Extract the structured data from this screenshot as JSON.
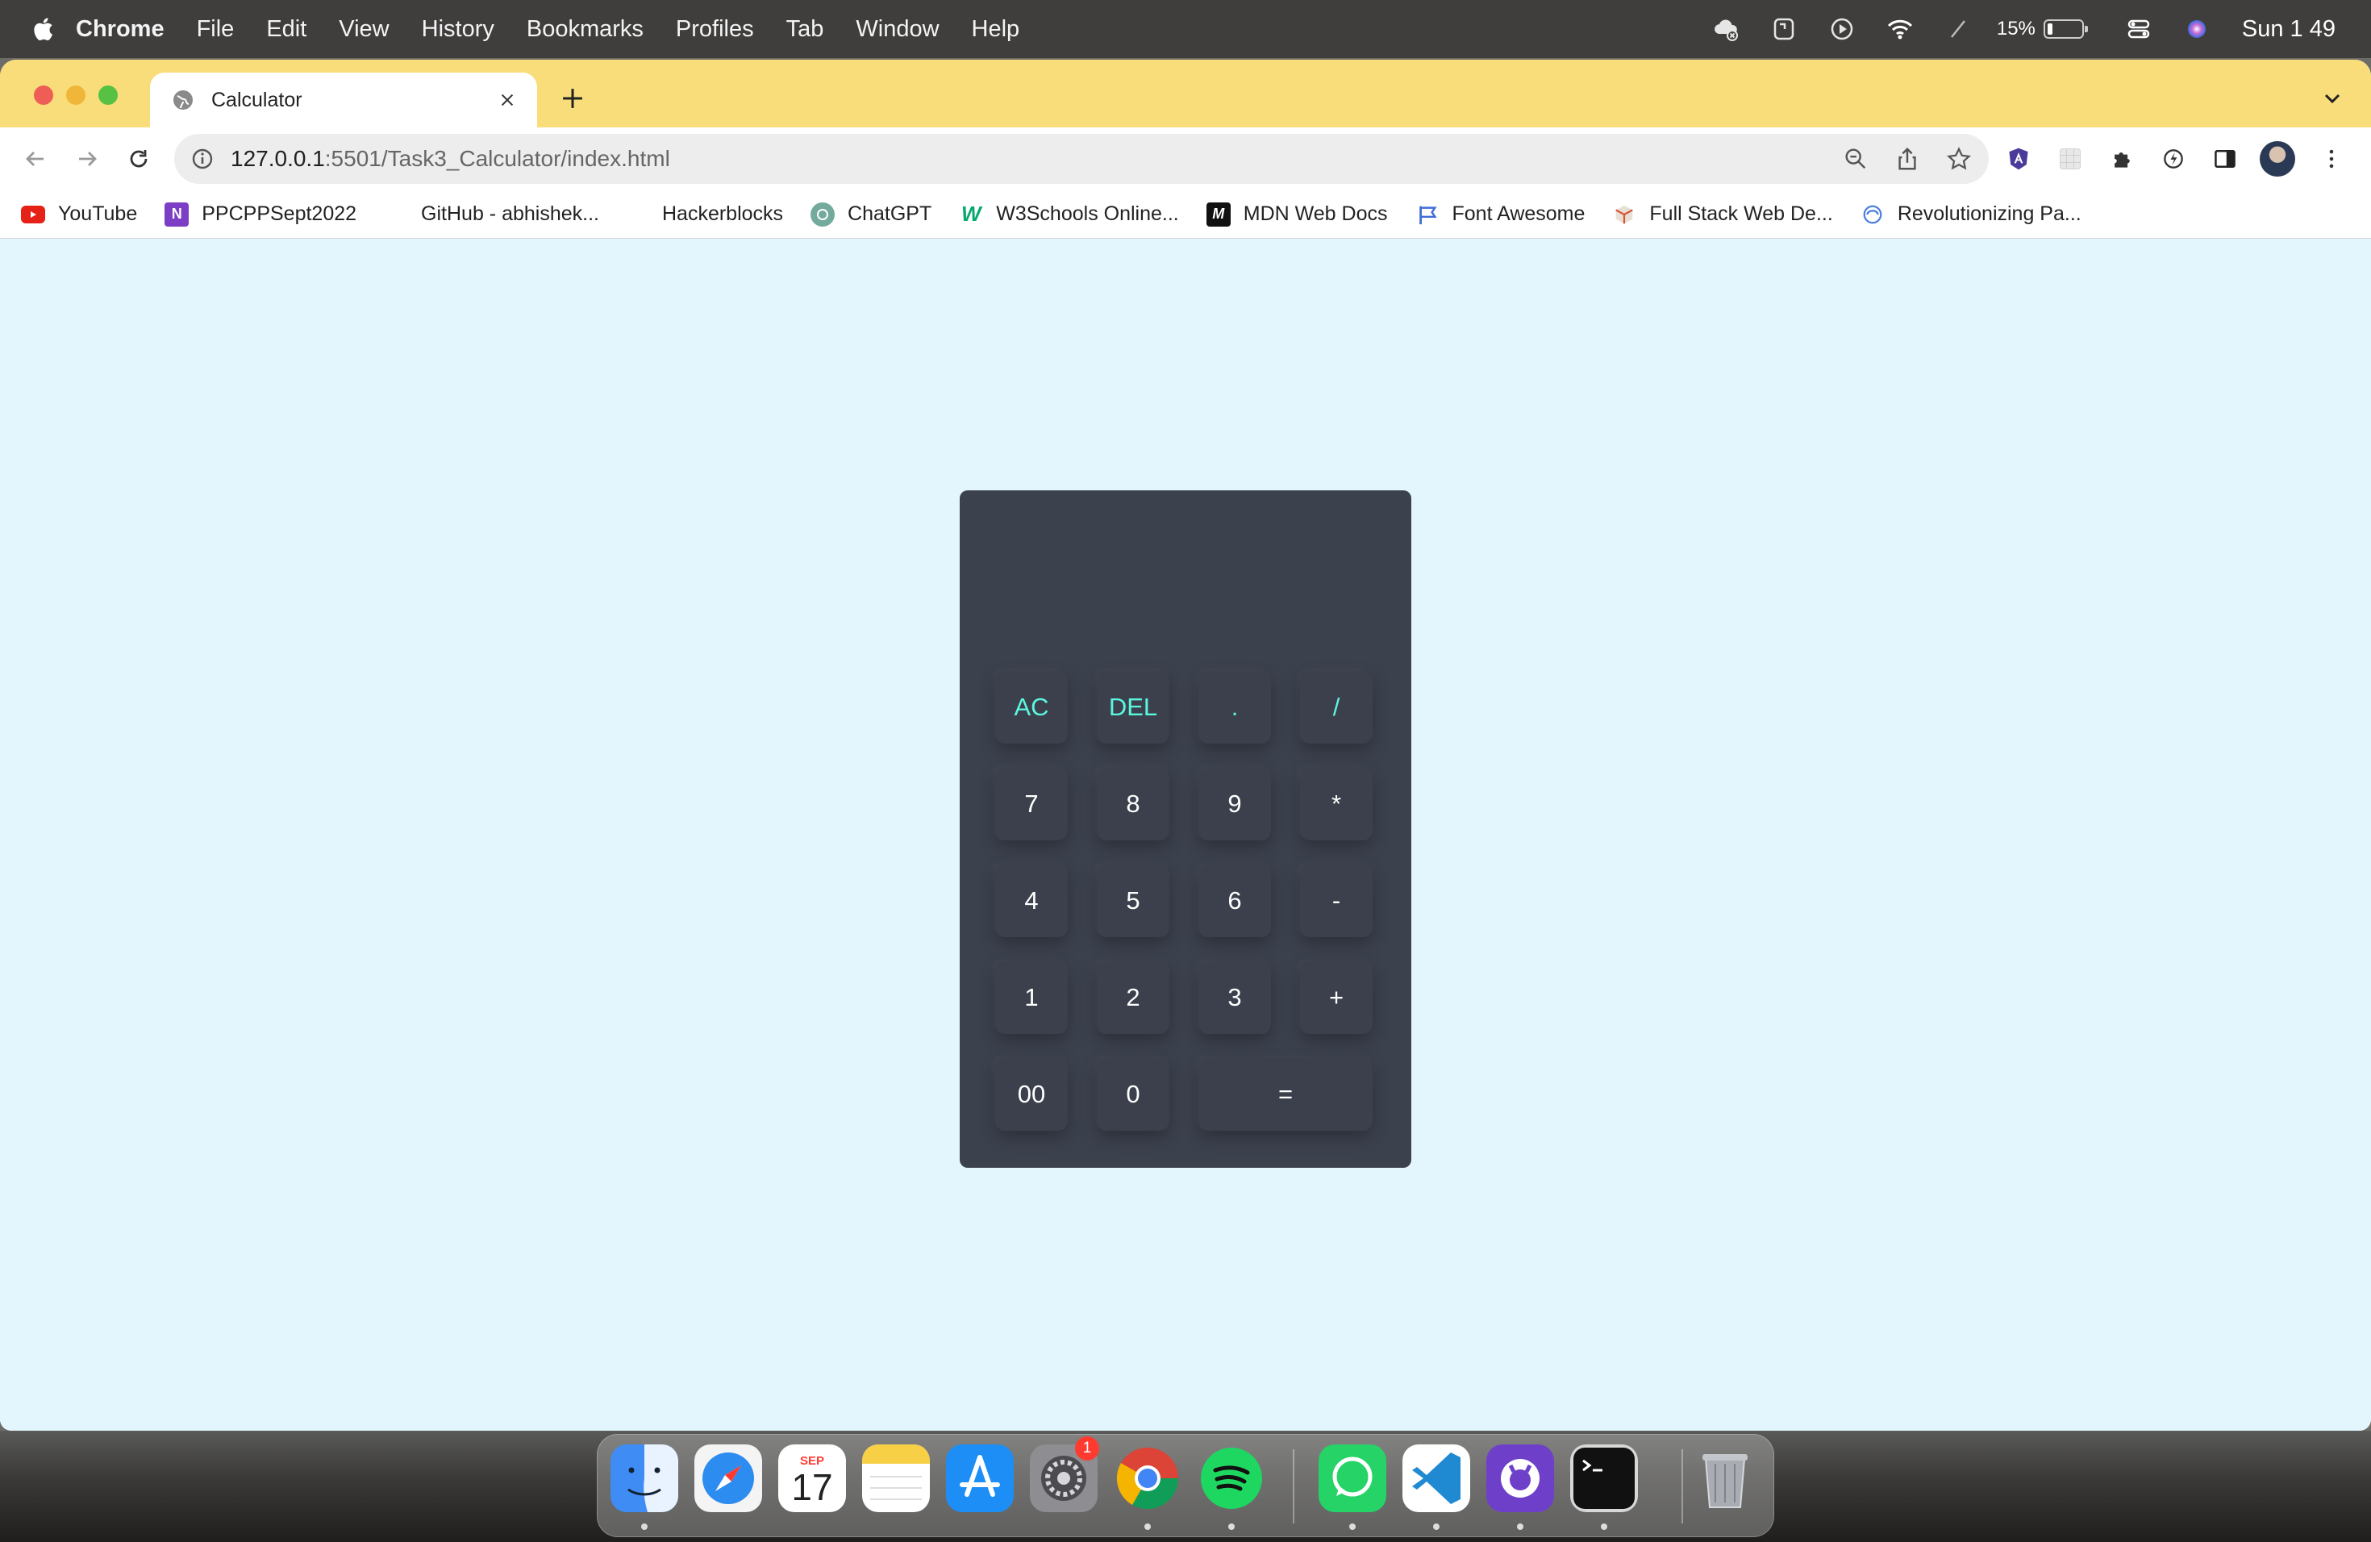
{
  "menubar": {
    "app_name": "Chrome",
    "items": [
      "File",
      "Edit",
      "View",
      "History",
      "Bookmarks",
      "Profiles",
      "Tab",
      "Window",
      "Help"
    ],
    "battery_percent": "15%",
    "battery_level": 0.15,
    "clock": "Sun 1 49"
  },
  "browser": {
    "tab_title": "Calculator",
    "url_host": "127.0.0.1",
    "url_rest": ":5501/Task3_Calculator/index.html",
    "bookmarks": [
      {
        "label": "YouTube",
        "icon": "youtube-icon"
      },
      {
        "label": "PPCPPSept2022",
        "icon": "onenote-icon"
      },
      {
        "label": "GitHub - abhishek...",
        "icon": "github-icon"
      },
      {
        "label": "Hackerblocks",
        "icon": "hackerblocks-icon"
      },
      {
        "label": "ChatGPT",
        "icon": "chatgpt-icon"
      },
      {
        "label": "W3Schools Online...",
        "icon": "w3schools-icon"
      },
      {
        "label": "MDN Web Docs",
        "icon": "mdn-icon"
      },
      {
        "label": "Font Awesome",
        "icon": "flag-icon"
      },
      {
        "label": "Full Stack Web De...",
        "icon": "cube-icon"
      },
      {
        "label": "Revolutionizing Pa...",
        "icon": "globe-icon"
      }
    ]
  },
  "calculator": {
    "display_value": "",
    "keys": {
      "ac": "AC",
      "del": "DEL",
      "dot": ".",
      "divide": "/",
      "seven": "7",
      "eight": "8",
      "nine": "9",
      "multiply": "*",
      "four": "4",
      "five": "5",
      "six": "6",
      "minus": "-",
      "one": "1",
      "two": "2",
      "three": "3",
      "plus": "+",
      "double_zero": "00",
      "zero": "0",
      "equals": "="
    },
    "colors": {
      "body": "#3c414e",
      "accent_text": "#5cf6e0",
      "page_bg": "#e3f6fd"
    }
  },
  "dock": {
    "calendar_month": "SEP",
    "calendar_day": "17",
    "settings_badge": "1",
    "apps": [
      "Finder",
      "Safari",
      "Calendar",
      "Notes",
      "App Store",
      "System Settings",
      "Chrome",
      "Spotify",
      "WhatsApp",
      "Visual Studio Code",
      "GitHub Desktop",
      "Terminal",
      "Trash"
    ]
  },
  "colors": {
    "tabstrip": "#f8dd7a",
    "menubar": "#3f3e3d"
  }
}
